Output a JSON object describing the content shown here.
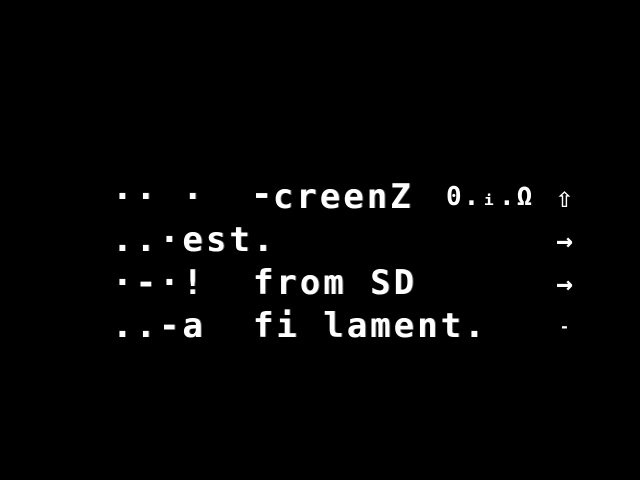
{
  "menu": {
    "items": [
      {
        "label": "·· ·  ⁃creenZ",
        "value": "0.ᵢ.Ω",
        "arrow": "⇧"
      },
      {
        "label": "..·est.",
        "value": "",
        "arrow": "→"
      },
      {
        "label": "·-·!  from SD",
        "value": "",
        "arrow": "→"
      },
      {
        "label": "..-a  fi lament.",
        "value": "",
        "arrow": "-"
      }
    ]
  },
  "colors": {
    "background": "#000000",
    "foreground": "#ffffff"
  }
}
